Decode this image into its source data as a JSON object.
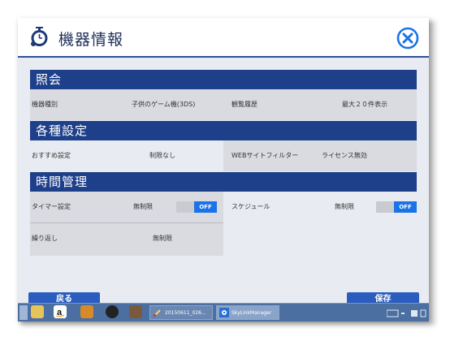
{
  "window": {
    "title": "機器情報",
    "close_icon": "close-circle-icon",
    "app_icon": "timer-person-icon"
  },
  "sections": {
    "inquiry": {
      "header": "照会",
      "device_type_label": "機器種別",
      "device_type_value": "子供のゲーム機(3DS)",
      "history_label": "観覧履歴",
      "history_value": "最大２０件表示"
    },
    "settings": {
      "header": "各種設定",
      "recommend_label": "おすすめ設定",
      "recommend_value": "制限なし",
      "web_filter_label": "WEBサイトフィルター",
      "web_filter_value": "ライセンス無効"
    },
    "time": {
      "header": "時間管理",
      "timer_label": "タイマー設定",
      "timer_value": "無制限",
      "timer_toggle": "OFF",
      "schedule_label": "スケジュール",
      "schedule_value": "無制限",
      "schedule_toggle": "OFF",
      "repeat_label": "繰り返し",
      "repeat_value": "無制限"
    }
  },
  "buttons": {
    "back": "戻る",
    "save": "保存"
  },
  "taskbar": {
    "tasks": [
      "20150611_026...",
      "SkyLinkManager"
    ],
    "icons": [
      "folder-icon",
      "amazon-icon",
      "camera-app-icon",
      "media-icon",
      "tv-icon",
      "brush-icon",
      "gear-icon"
    ]
  },
  "colors": {
    "section_header": "#1e3f8a",
    "toggle_on": "#1a73e8",
    "title_accent": "#2f4f9a"
  }
}
